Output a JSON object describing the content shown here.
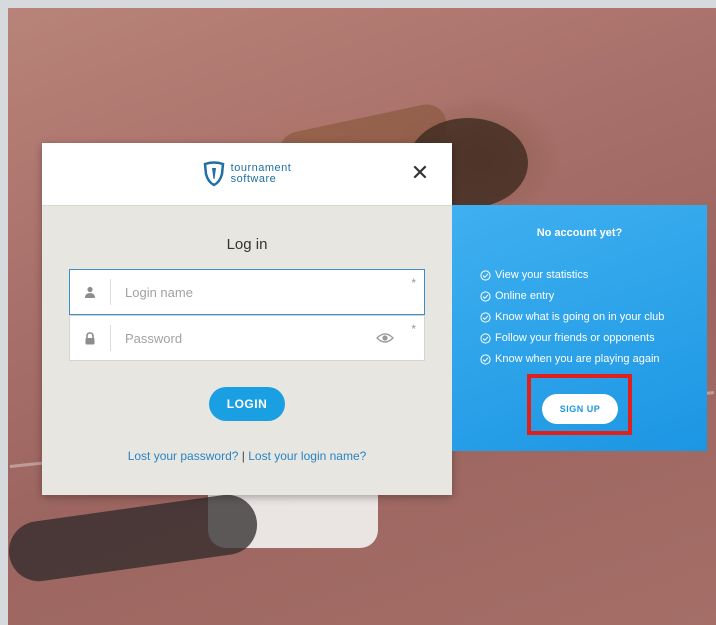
{
  "brand": {
    "line1": "tournament",
    "line2": "software"
  },
  "login": {
    "title": "Log in",
    "login_name_placeholder": "Login name",
    "password_placeholder": "Password",
    "required_marker": "*",
    "button_label": "LOGIN",
    "lost_password": "Lost your password?",
    "separator": "|",
    "lost_login_name": "Lost your login name?"
  },
  "close_label": "✕",
  "signup": {
    "title": "No account yet?",
    "benefits": [
      "View your statistics",
      "Online entry",
      "Know what is going on in your club",
      "Follow your friends or opponents",
      "Know when you are playing again"
    ],
    "button_label": "SIGN UP"
  },
  "colors": {
    "brand_blue": "#1f6fa3",
    "button_blue": "#1a9fe3",
    "panel_blue": "#1c96e3",
    "highlight_red": "#e0201b"
  }
}
